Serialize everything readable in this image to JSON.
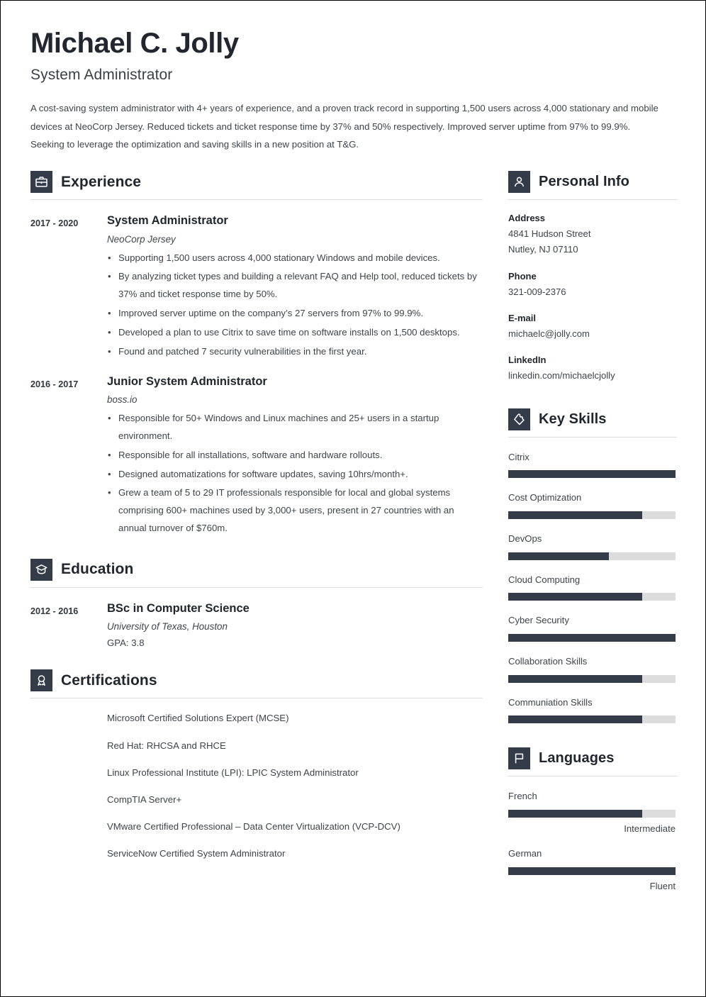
{
  "header": {
    "name": "Michael C. Jolly",
    "job_title": "System Administrator",
    "summary": "A cost-saving system administrator with 4+ years of experience, and a proven track record in supporting 1,500 users across 4,000 stationary and mobile devices at NeoCorp Jersey. Reduced tickets and ticket response time by 37% and 50% respectively. Improved server uptime from 97% to 99.9%. Seeking to leverage the optimization and saving skills in a new position at T&G."
  },
  "experience": {
    "title": "Experience",
    "icon": "briefcase-icon",
    "entries": [
      {
        "dates": "2017 - 2020",
        "role": "System Administrator",
        "org": "NeoCorp Jersey",
        "bullets": [
          "Supporting 1,500 users across 4,000 stationary Windows and mobile devices.",
          "By analyzing ticket types and building a relevant FAQ and Help tool, reduced tickets by 37% and ticket response time by 50%.",
          "Improved server uptime on the company’s 27 servers from 97% to 99.9%.",
          "Developed a plan to use Citrix to save time on software installs on 1,500 desktops.",
          "Found and patched 7 security vulnerabilities in the first year."
        ]
      },
      {
        "dates": "2016 - 2017",
        "role": "Junior System Administrator",
        "org": "boss.io",
        "bullets": [
          "Responsible for 50+ Windows and Linux machines and 25+ users in a startup environment.",
          "Responsible for all installations, software and hardware rollouts.",
          "Designed automatizations for software updates, saving 10hrs/month+.",
          "Grew a team of 5 to 29 IT professionals responsible for local and global systems comprising 600+ machines used by 3,000+ users, present in 27 countries with an annual turnover of $760m."
        ]
      }
    ]
  },
  "education": {
    "title": "Education",
    "icon": "graduation-cap-icon",
    "entries": [
      {
        "dates": "2012 - 2016",
        "degree": "BSc in Computer Science",
        "school": "University of Texas, Houston",
        "gpa": "GPA: 3.8"
      }
    ]
  },
  "certifications": {
    "title": "Certifications",
    "icon": "award-icon",
    "items": [
      "Microsoft Certified Solutions Expert (MCSE)",
      "Red Hat: RHCSA and RHCE",
      "Linux Professional Institute (LPI): LPIC System Administrator",
      "CompTIA Server+",
      "VMware Certified Professional – Data Center Virtualization (VCP-DCV)",
      "ServiceNow Certified System Administrator"
    ]
  },
  "personal_info": {
    "title": "Personal Info",
    "icon": "person-icon",
    "groups": [
      {
        "label": "Address",
        "lines": [
          "4841 Hudson Street",
          "Nutley, NJ 07110"
        ]
      },
      {
        "label": "Phone",
        "lines": [
          "321-009-2376"
        ]
      },
      {
        "label": "E-mail",
        "lines": [
          "michaelc@jolly.com"
        ]
      },
      {
        "label": "LinkedIn",
        "lines": [
          "linkedin.com/michaelcjolly"
        ]
      }
    ]
  },
  "key_skills": {
    "title": "Key Skills",
    "icon": "puzzle-piece-icon",
    "items": [
      {
        "name": "Citrix",
        "level": 100
      },
      {
        "name": "Cost Optimization",
        "level": 80
      },
      {
        "name": "DevOps",
        "level": 60
      },
      {
        "name": "Cloud Computing",
        "level": 80
      },
      {
        "name": "Cyber Security",
        "level": 100
      },
      {
        "name": "Collaboration Skills",
        "level": 80
      },
      {
        "name": "Communiation Skills",
        "level": 80
      }
    ]
  },
  "languages": {
    "title": "Languages",
    "icon": "flag-icon",
    "items": [
      {
        "name": "French",
        "level": 80,
        "label": "Intermediate"
      },
      {
        "name": "German",
        "level": 100,
        "label": "Fluent"
      }
    ]
  },
  "colors": {
    "dark": "#343c4a",
    "text": "#3f434b",
    "heading": "#22262f",
    "bar_track": "#dcdcdc",
    "rule": "#d9dadd"
  }
}
